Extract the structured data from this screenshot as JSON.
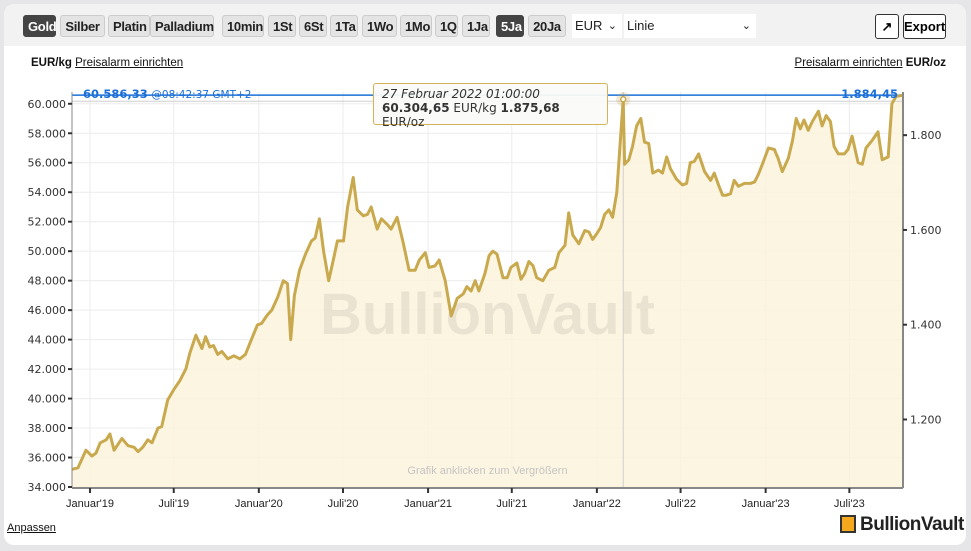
{
  "toolbar": {
    "metals": [
      {
        "label": "Gold",
        "active": true
      },
      {
        "label": "Silber",
        "active": false
      },
      {
        "label": "Platin",
        "active": false
      },
      {
        "label": "Palladium",
        "active": false
      }
    ],
    "ranges": [
      {
        "label": "10min",
        "active": false
      },
      {
        "label": "1St",
        "active": false
      },
      {
        "label": "6St",
        "active": false
      },
      {
        "label": "1Ta",
        "active": false
      },
      {
        "label": "1Wo",
        "active": false
      },
      {
        "label": "1Mo",
        "active": false
      },
      {
        "label": "1Q",
        "active": false
      },
      {
        "label": "1Ja",
        "active": false
      },
      {
        "label": "5Ja",
        "active": true
      },
      {
        "label": "20Ja",
        "active": false
      }
    ],
    "currency": "EUR",
    "chart_type": "Linie",
    "export_label": "Export",
    "popout_icon": "external-link-icon"
  },
  "units": {
    "left_unit": "EUR/kg",
    "left_alarm": "Preisalarm einrichten",
    "right_alarm": "Preisalarm einrichten",
    "right_unit": "EUR/oz"
  },
  "current": {
    "price_kg": "60.586,33",
    "time": "@08:42:37 GMT+2",
    "price_oz": "1.884,45"
  },
  "tooltip": {
    "date": "27 Februar 2022 01:00:00",
    "price_kg": "60.304,65",
    "unit_kg": "EUR/kg",
    "price_oz": "1.875,68",
    "unit_oz": "EUR/oz"
  },
  "watermark": "BullionVault",
  "hint": "Grafik anklicken zum Vergrößern",
  "footer": {
    "customize": "Anpassen",
    "logo": "BullionVault"
  },
  "colors": {
    "line": "#c9a94e",
    "fill": "#fcf3dc",
    "current": "#1a6fd8",
    "text_link": "#1a6fd8"
  },
  "chart_data": {
    "type": "area",
    "xlabel": "",
    "ylabel": "",
    "y_left_unit": "EUR/kg",
    "y_right_unit": "EUR/oz",
    "x_range": [
      "2018-11-23",
      "2023-10-25"
    ],
    "ylim": [
      34000,
      60800
    ],
    "y_left_ticks": [
      34000,
      36000,
      38000,
      40000,
      42000,
      44000,
      46000,
      48000,
      50000,
      52000,
      54000,
      56000,
      58000,
      60000
    ],
    "y_left_tick_labels": [
      "34.000",
      "36.000",
      "38.000",
      "40.000",
      "42.000",
      "44.000",
      "46.000",
      "48.000",
      "50.000",
      "52.000",
      "54.000",
      "56.000",
      "58.000",
      "60.000"
    ],
    "y_right_ticks": [
      1200,
      1400,
      1600,
      1800
    ],
    "y_right_tick_labels": [
      "1.200",
      "1.400",
      "1.600",
      "1.800"
    ],
    "x_ticks": [
      "2019-01-01",
      "2019-07-01",
      "2020-01-01",
      "2020-07-01",
      "2021-01-01",
      "2021-07-01",
      "2022-01-01",
      "2022-07-01",
      "2023-01-01",
      "2023-07-01"
    ],
    "x_tick_labels": [
      "Januar'19",
      "Juli'19",
      "Januar'20",
      "Juli'20",
      "Januar'21",
      "Juli'21",
      "Januar'22",
      "Juli'22",
      "Januar'23",
      "Juli'23"
    ],
    "grid": true,
    "highlight": {
      "date": "2022-02-27",
      "value": 60304.65
    },
    "current_value": 60586.33,
    "series": [
      {
        "x": [
          "2018-11-23",
          "2018-12-06",
          "2018-12-23",
          "2019-01-05",
          "2019-01-14",
          "2019-01-23",
          "2019-02-05",
          "2019-02-13",
          "2019-02-22",
          "2019-03-11",
          "2019-03-24",
          "2019-04-06",
          "2019-04-15",
          "2019-04-25",
          "2019-05-06",
          "2019-05-15",
          "2019-05-28",
          "2019-06-05",
          "2019-06-18",
          "2019-07-01",
          "2019-07-14",
          "2019-07-27",
          "2019-08-05",
          "2019-08-18",
          "2019-08-31",
          "2019-09-08",
          "2019-09-17",
          "2019-09-25",
          "2019-10-04",
          "2019-10-13",
          "2019-10-26",
          "2019-11-08",
          "2019-11-21",
          "2019-12-03",
          "2019-12-16",
          "2019-12-29",
          "2020-01-07",
          "2020-01-20",
          "2020-01-29",
          "2020-02-11",
          "2020-02-23",
          "2020-03-03",
          "2020-03-10",
          "2020-03-18",
          "2020-03-29",
          "2020-04-11",
          "2020-04-24",
          "2020-05-02",
          "2020-05-11",
          "2020-05-20",
          "2020-05-31",
          "2020-06-10",
          "2020-06-19",
          "2020-07-02",
          "2020-07-11",
          "2020-07-23",
          "2020-08-01",
          "2020-08-14",
          "2020-08-23",
          "2020-08-31",
          "2020-09-13",
          "2020-09-22",
          "2020-10-05",
          "2020-10-13",
          "2020-10-26",
          "2020-11-08",
          "2020-11-21",
          "2020-12-04",
          "2020-12-13",
          "2020-12-26",
          "2021-01-03",
          "2021-01-16",
          "2021-01-25",
          "2021-02-07",
          "2021-02-20",
          "2021-03-05",
          "2021-03-18",
          "2021-03-26",
          "2021-04-04",
          "2021-04-13",
          "2021-04-21",
          "2021-05-04",
          "2021-05-13",
          "2021-05-21",
          "2021-05-30",
          "2021-06-12",
          "2021-06-21",
          "2021-06-29",
          "2021-07-12",
          "2021-07-21",
          "2021-07-29",
          "2021-08-07",
          "2021-08-16",
          "2021-08-24",
          "2021-09-06",
          "2021-09-19",
          "2021-10-02",
          "2021-10-11",
          "2021-10-24",
          "2021-11-01",
          "2021-11-10",
          "2021-11-23",
          "2021-12-06",
          "2021-12-15",
          "2021-12-23",
          "2022-01-01",
          "2022-01-09",
          "2022-01-18",
          "2022-01-27",
          "2022-02-04",
          "2022-02-13",
          "2022-02-27",
          "2022-03-02",
          "2022-03-11",
          "2022-03-19",
          "2022-03-28",
          "2022-04-06",
          "2022-04-14",
          "2022-04-23",
          "2022-05-02",
          "2022-05-14",
          "2022-05-23",
          "2022-06-01",
          "2022-06-09",
          "2022-06-22",
          "2022-07-05",
          "2022-07-14",
          "2022-07-22",
          "2022-07-31",
          "2022-08-09",
          "2022-08-22",
          "2022-09-04",
          "2022-09-12",
          "2022-09-21",
          "2022-09-30",
          "2022-10-08",
          "2022-10-17",
          "2022-10-25",
          "2022-11-03",
          "2022-11-16",
          "2022-11-29",
          "2022-12-08",
          "2022-12-16",
          "2022-12-25",
          "2023-01-07",
          "2023-01-20",
          "2023-01-28",
          "2023-02-06",
          "2023-02-19",
          "2023-02-28",
          "2023-03-08",
          "2023-03-17",
          "2023-03-25",
          "2023-04-03",
          "2023-04-12",
          "2023-04-25",
          "2023-05-03",
          "2023-05-12",
          "2023-05-21",
          "2023-05-29",
          "2023-06-07",
          "2023-06-20",
          "2023-06-28",
          "2023-07-07",
          "2023-07-20",
          "2023-07-29",
          "2023-08-06",
          "2023-08-19",
          "2023-09-01",
          "2023-09-10",
          "2023-09-23",
          "2023-10-01",
          "2023-10-10",
          "2023-10-25"
        ],
        "y": [
          35200,
          35300,
          36500,
          36100,
          36300,
          37000,
          37200,
          37600,
          36500,
          37300,
          36800,
          36700,
          36400,
          36700,
          37200,
          37000,
          38000,
          38100,
          39900,
          40600,
          41200,
          42000,
          43100,
          44300,
          43400,
          44200,
          43500,
          43600,
          43000,
          43200,
          42700,
          42900,
          42700,
          43000,
          44000,
          45000,
          45100,
          45700,
          46000,
          46900,
          48000,
          47800,
          44000,
          47000,
          48700,
          49800,
          50700,
          50900,
          52200,
          50000,
          48000,
          49400,
          50700,
          50700,
          53000,
          55000,
          52800,
          52400,
          52500,
          53000,
          51500,
          52200,
          51800,
          51500,
          52300,
          50600,
          48700,
          48700,
          49400,
          49900,
          48900,
          49000,
          49400,
          48000,
          45600,
          46800,
          47100,
          47600,
          47300,
          48000,
          47300,
          48500,
          49700,
          50000,
          49800,
          48200,
          48200,
          48900,
          49200,
          48100,
          48500,
          49300,
          49000,
          48200,
          48000,
          48700,
          48900,
          49900,
          50400,
          52600,
          51100,
          50500,
          51400,
          51300,
          50800,
          51200,
          51600,
          52500,
          52800,
          52300,
          54000,
          60305,
          55900,
          56200,
          57100,
          58500,
          59000,
          57400,
          57300,
          55300,
          55500,
          55300,
          56400,
          55600,
          54900,
          54500,
          54600,
          56000,
          56100,
          56600,
          55400,
          54800,
          55300,
          54500,
          53800,
          53800,
          53900,
          54800,
          54400,
          54600,
          54600,
          54700,
          55200,
          55900,
          57000,
          56900,
          56300,
          55400,
          56300,
          57500,
          59000,
          58300,
          58900,
          58200,
          58800,
          59500,
          58500,
          59200,
          58800,
          57100,
          56600,
          56600,
          56900,
          57800,
          56000,
          55900,
          57000,
          57500,
          58100,
          56200,
          56400,
          60000,
          60500,
          60586
        ]
      }
    ]
  }
}
